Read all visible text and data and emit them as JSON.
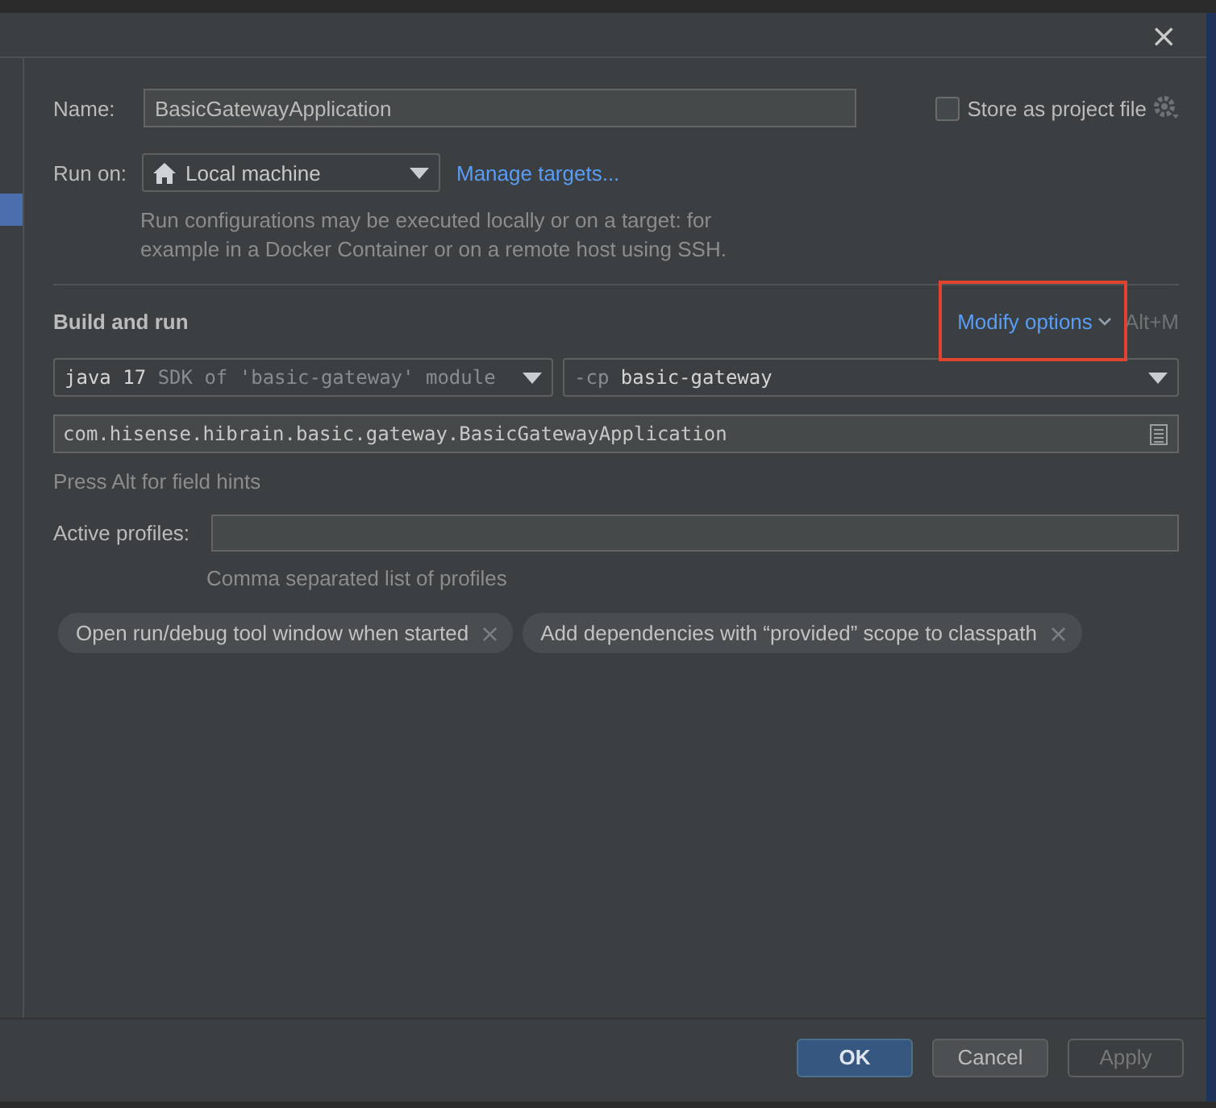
{
  "window": {
    "close": "×"
  },
  "name": {
    "label": "Name:",
    "value": "BasicGatewayApplication"
  },
  "store_as_project_file": {
    "label": "Store as project file",
    "checked": false
  },
  "run_on": {
    "label": "Run on:",
    "value": "Local machine",
    "link": "Manage targets..."
  },
  "run_on_hint": "Run configurations may be executed locally or on a target: for example in a Docker Container or on a remote host using SSH.",
  "build_and_run": {
    "title": "Build and run",
    "modify_options": {
      "label": "Modify options",
      "shortcut": "Alt+M",
      "highlighted": true
    },
    "jre": {
      "value": "java 17",
      "detail": "SDK of 'basic-gateway' module"
    },
    "classpath": {
      "prefix": "-cp",
      "value": "basic-gateway"
    },
    "main_class": "com.hisense.hibrain.basic.gateway.BasicGatewayApplication",
    "field_hint": "Press Alt for field hints"
  },
  "active_profiles": {
    "label": "Active profiles:",
    "hint": "Comma separated list of profiles"
  },
  "options": [
    {
      "label": "Open run/debug tool window when started",
      "remove": "×"
    },
    {
      "label": "Add dependencies with “provided” scope to classpath",
      "remove": "×"
    }
  ],
  "buttons": [
    {
      "label": "OK",
      "kind": "default",
      "disabled": false
    },
    {
      "label": "Cancel",
      "kind": "normal",
      "disabled": false
    },
    {
      "label": "Apply",
      "kind": "normal",
      "disabled": true
    }
  ]
}
